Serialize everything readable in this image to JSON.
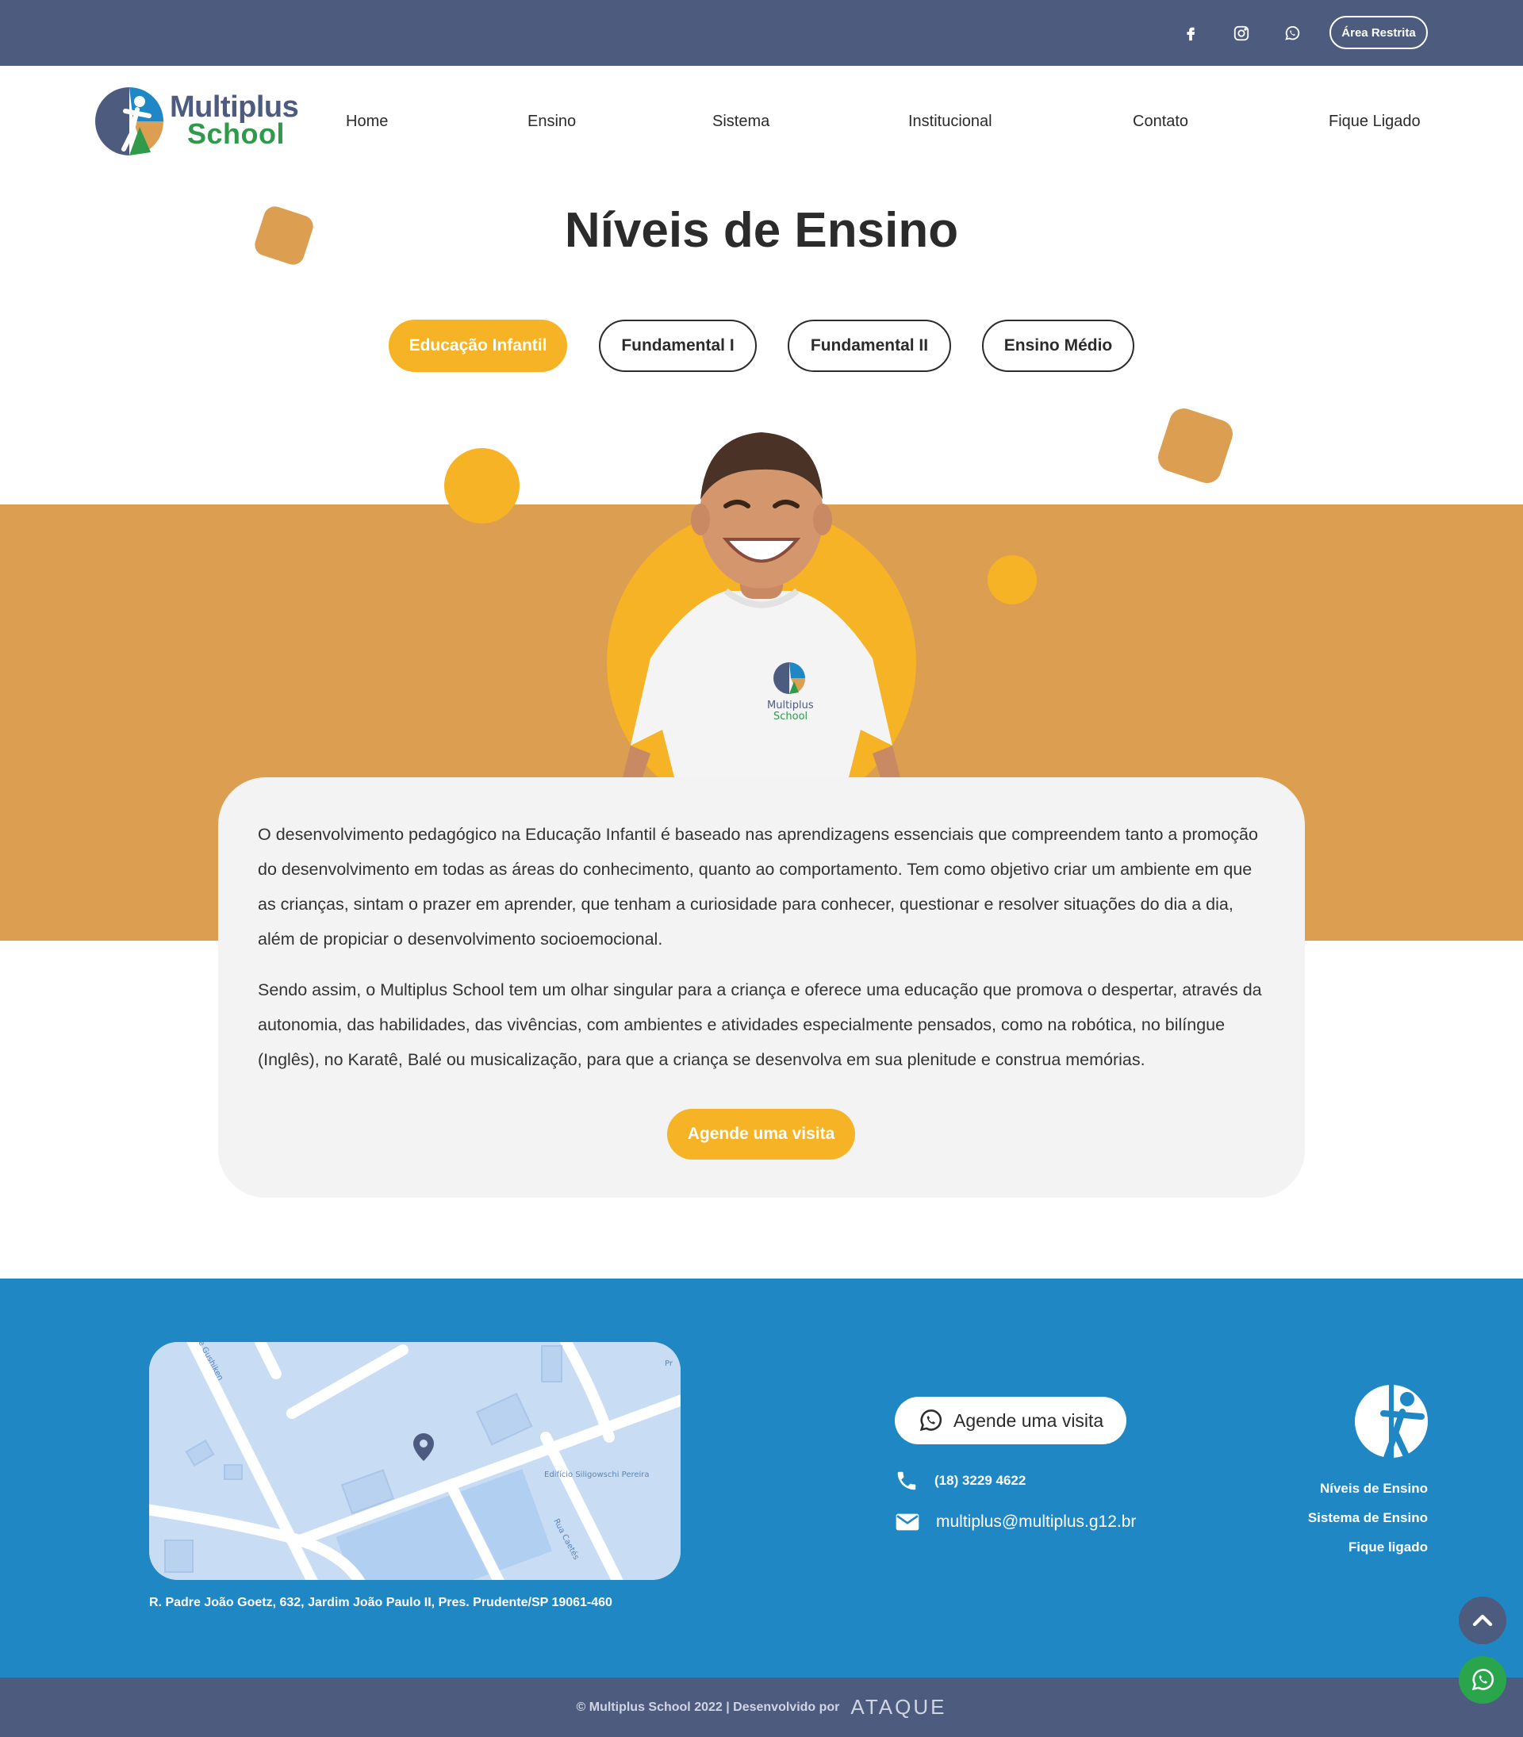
{
  "topbar": {
    "social": [
      {
        "name": "facebook-icon"
      },
      {
        "name": "instagram-icon"
      },
      {
        "name": "whatsapp-icon"
      }
    ],
    "restricted_area_label": "Área Restrita"
  },
  "header": {
    "logo_line1": "Multiplus",
    "logo_line2": "School",
    "nav": [
      "Home",
      "Ensino",
      "Sistema",
      "Institucional",
      "Contato",
      "Fique Ligado"
    ]
  },
  "hero": {
    "title": "Níveis de Ensino",
    "tabs": [
      {
        "label": "Educação Infantil",
        "active": true
      },
      {
        "label": "Fundamental I",
        "active": false
      },
      {
        "label": "Fundamental II",
        "active": false
      },
      {
        "label": "Ensino Médio",
        "active": false
      }
    ],
    "shirt_logo_line1": "Multiplus",
    "shirt_logo_line2": "School"
  },
  "content": {
    "paragraph1": "O desenvolvimento pedagógico na Educação Infantil é baseado nas aprendizagens essenciais que compreendem tanto a promoção do desenvolvimento em todas as áreas do conhecimento, quanto ao comportamento. Tem como objetivo criar um ambiente em que as crianças, sintam o prazer em aprender, que tenham a curiosidade para conhecer, questionar e resolver situações do dia a dia, além de propiciar o desenvolvimento socioemocional.",
    "paragraph2": "Sendo assim, o Multiplus School tem um olhar singular para a criança e oferece uma educação que promova o despertar, através da autonomia, das habilidades, das vivências, com ambientes e atividades especialmente pensados, como na robótica, no bilíngue (Inglês), no Karatê, Balé ou musicalização, para que a criança se desenvolva em sua plenitude e construa memórias.",
    "cta_label": "Agende uma visita"
  },
  "footer": {
    "map": {
      "street_labels": [
        "Rua Caetés",
        "Edifício Siligowschi Pereira",
        "e Gushiken",
        "Pr"
      ]
    },
    "address": "R. Padre João Goetz, 632, Jardim João Paulo II, Pres. Prudente/SP 19061-460",
    "whatsapp_cta": "Agende uma visita",
    "phone": "(18) 3229 4622",
    "email": "multiplus@multiplus.g12.br",
    "links": [
      "Níveis de Ensino",
      "Sistema de Ensino",
      "Fique ligado"
    ],
    "copyright": "© Multiplus School 2022 | Desenvolvido por",
    "developer": "ATAQUE"
  },
  "colors": {
    "navy": "#4d5b7f",
    "orange": "#dc9e51",
    "yellow": "#f5b325",
    "footer_blue": "#1f87c3",
    "green": "#2e9a4a"
  }
}
